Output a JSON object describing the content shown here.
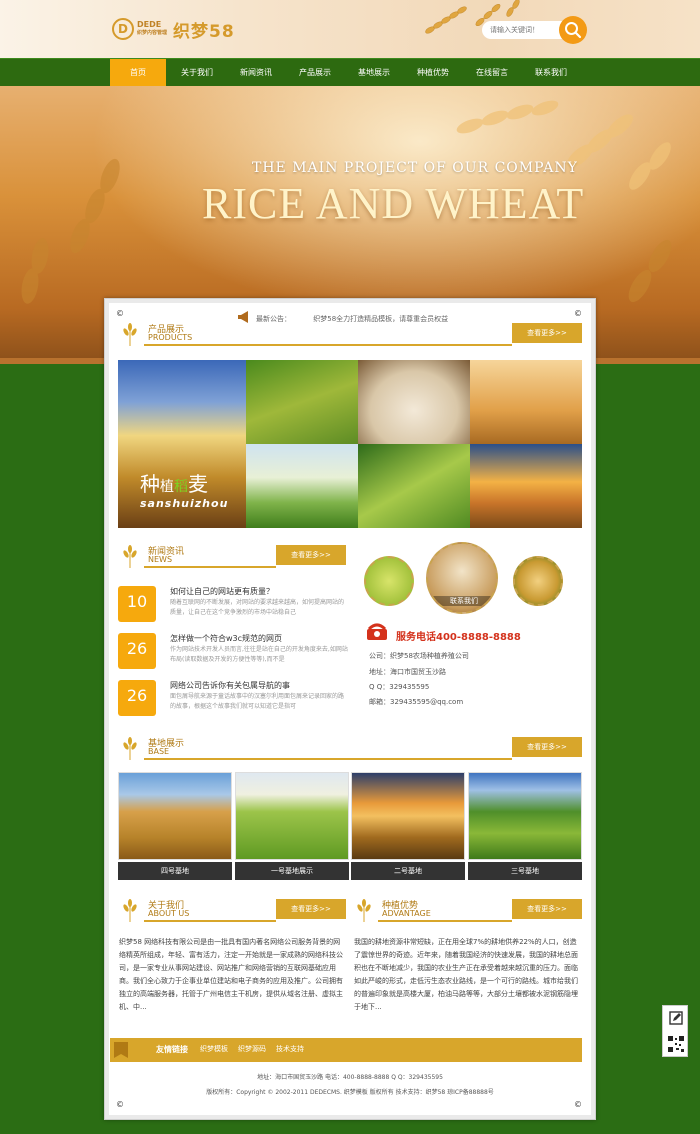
{
  "header": {
    "logo_mark": "D",
    "logo_text_top": "DEDE",
    "logo_text_bottom": "织梦内容管理",
    "logo_cn": "织梦58",
    "search_placeholder": "请输入关键词！"
  },
  "nav": {
    "items": [
      "首页",
      "关于我们",
      "新闻资讯",
      "产品展示",
      "基地展示",
      "种植优势",
      "在线留言",
      "联系我们"
    ],
    "active_index": 0
  },
  "hero": {
    "subtitle": "THE MAIN PROJECT OF OUR COMPANY",
    "title": "RICE AND WHEAT"
  },
  "notice": {
    "label": "最新公告：",
    "text": "织梦58全力打造精品模板，请尊重会员权益"
  },
  "products": {
    "title_cn": "产品展示",
    "title_en": "PRODUCTS",
    "more": "查看更多>>",
    "overlay_cn_a": "种",
    "overlay_cn_b": "植",
    "overlay_cn_c": "稻",
    "overlay_cn_d": "麦",
    "overlay_en": "sanshuizhou"
  },
  "news": {
    "title_cn": "新闻资讯",
    "title_en": "NEWS",
    "more": "查看更多>>",
    "items": [
      {
        "day": "10",
        "title": "如何让自己的网站更有质量？",
        "desc": "随着互联网的不断发展，对网站的要求越来越高，如何提高网站的质量，让自己在这个竞争激烈的市场中站稳自己"
      },
      {
        "day": "26",
        "title": "怎样做一个符合w3c规范的网页",
        "desc": "作为网站技术开发人员而言,往往是站在自己的开发角度来去,如网站布局(读取数据及开发的方便性等等),而不是"
      },
      {
        "day": "26",
        "title": "网络公司告诉你有关包属导航的事",
        "desc": "面包屑导航来源于童话故事中的汉塞尔利用面包屑来记录回家的路的故事，根据这个故事我们就可以知道它是指可"
      }
    ]
  },
  "contact": {
    "circle_label": "联系我们",
    "hotline_label": "服务电话",
    "hotline": "400-8888-8888",
    "company": "公司：织梦58农场种植养殖公司",
    "address": "地址：海口市国贸玉沙路",
    "qq": "Q Q：329435595",
    "email": "邮箱：329435595@qq.com"
  },
  "base": {
    "title_cn": "基地展示",
    "title_en": "BASE",
    "more": "查看更多>>",
    "items": [
      "四号基地",
      "一号基地展示",
      "二号基地",
      "三号基地"
    ]
  },
  "about": {
    "title_cn": "关于我们",
    "title_en": "ABOUT US",
    "more": "查看更多>>",
    "text": "织梦58 网络科技有限公司是由一批具有国内著名网络公司服务背景的网络精英所组成，年轻、富有活力，注定一开始就是一家成熟的网络科技公司，是一家专业从事网站建设、网站推广和网络营销的互联网基础应用商。我们全心致力于企事业单位建站和电子商务的应用及推广。公司拥有独立的高端服务器，托管于广州电信主干机房，提供从域名注册、虚拟主机、中..."
  },
  "advantage": {
    "title_cn": "种植优势",
    "title_en": "ADVANTAGE",
    "more": "查看更多>>",
    "text": "我国的耕地资源非常短缺，正在用全球7%的耕地供养22%的人口，创造了震惊世界的奇迹。近年来，随着我国经济的快速发展，我国的耕地总面积也在不断地减少，我国的农业生产正在承受着越来越沉重的压力。面临如此严峻的形式，走低污生态农业路线，是一个可行的路线。城市给我们的普遍印象就是高楼大厦，柏油马路等等，大部分土壤都被水泥钢筋隐埋于地下..."
  },
  "friends": {
    "title": "友情链接",
    "links": [
      "织梦模板",
      "织梦源码",
      "技术支持"
    ]
  },
  "footer": {
    "line1": "地址：海口市国贸玉沙路    电话：400-8888-8888    Q Q：329435595",
    "line2": "版权所有：Copyright © 2002-2011 DEDECMS. 织梦模板 版权所有    技术支持：织梦58    琼ICP备88888号"
  },
  "colors": {
    "accent": "#f6a90d",
    "gold": "#d8a62b",
    "nav_green": "#2d6a10",
    "background_green": "#2b6d14",
    "hotline_red": "#d4321c"
  }
}
